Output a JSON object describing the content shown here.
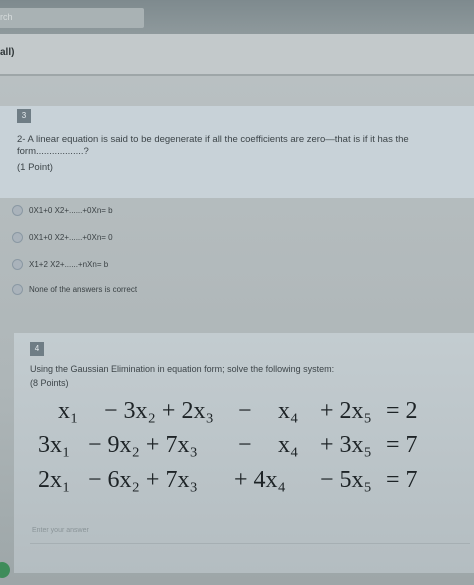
{
  "header": {
    "search_text": "rch",
    "subheader_text": "all)"
  },
  "question3": {
    "number": "3",
    "prompt": "2- A linear equation is said to be degenerate if all the coefficients are zero—that is if it has the form..................?",
    "points": "(1 Point)",
    "options": [
      {
        "label": "0X1+0 X2+......+0Xn= b"
      },
      {
        "label": "0X1+0 X2+......+0Xn= 0"
      },
      {
        "label": "X1+2 X2+......+nXn= b"
      },
      {
        "label": "None of the answers is correct"
      }
    ]
  },
  "question4": {
    "number": "4",
    "prompt": "Using the Gaussian Elimination in equation form; solve the following system:",
    "points": "(8 Points)",
    "equations": [
      [
        "x₁",
        "− 3x₂ + 2x₃",
        "−",
        "x₄",
        "+ 2x₅",
        "= 2"
      ],
      [
        "3x₁",
        "− 9x₂ + 7x₃",
        "−",
        "x₄",
        "+ 3x₅",
        "= 7"
      ],
      [
        "2x₁",
        "− 6x₂ + 7x₃",
        "+ 4x₄",
        "",
        "− 5x₅",
        "= 7"
      ]
    ],
    "answer_placeholder": "Enter your answer"
  },
  "colors": {
    "accent": "#6f7d85",
    "status_dot": "#3f8c5a"
  }
}
